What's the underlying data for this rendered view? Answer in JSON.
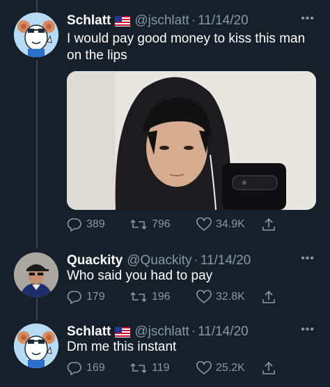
{
  "tweets": [
    {
      "name": "Schlatt",
      "handle": "@jschlatt",
      "date": "11/14/20",
      "text_line1": "I would pay good money to kiss this man",
      "text_line2": "on the lips",
      "replies": "389",
      "retweets": "796",
      "likes": "34.9K",
      "flag_icon": "us-flag-icon",
      "avatar": "ram-cartoon-avatar"
    },
    {
      "name": "Quackity",
      "handle": "@Quackity",
      "date": "11/14/20",
      "text_line1": "Who said you had to pay",
      "replies": "179",
      "retweets": "196",
      "likes": "32.8K",
      "avatar": "person-with-cap-avatar"
    },
    {
      "name": "Schlatt",
      "handle": "@jschlatt",
      "date": "11/14/20",
      "text_line1": "Dm me this instant",
      "replies": "169",
      "retweets": "119",
      "likes": "25.2K",
      "flag_icon": "us-flag-icon",
      "avatar": "ram-cartoon-avatar"
    }
  ],
  "separator": "·",
  "more": "•••",
  "colors": {
    "background": "#15202b",
    "text": "#ffffff",
    "secondary": "#8899a6",
    "thread_line": "#38444d"
  }
}
